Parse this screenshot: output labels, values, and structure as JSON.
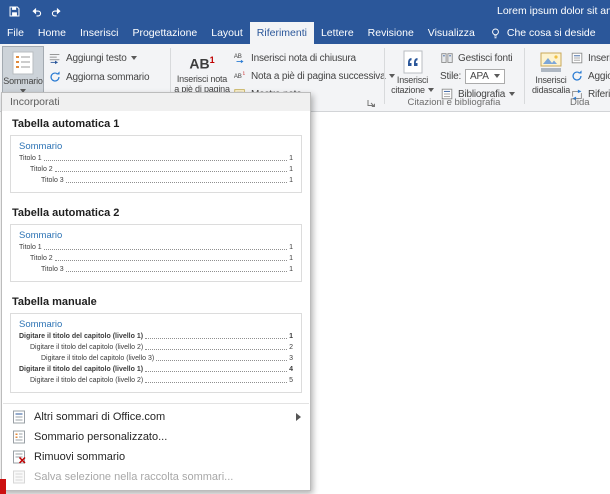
{
  "colors": {
    "titlebar": "#2b579a",
    "active_tab_text": "#2b579a",
    "toc_heading_blue": "#2e74b5",
    "ribbon_bg": "#f3f4f6"
  },
  "titlebar": {
    "title": "Lorem ipsum dolor sit amet - Wo"
  },
  "tabs": {
    "file": "File",
    "items": [
      {
        "label": "Home"
      },
      {
        "label": "Inserisci"
      },
      {
        "label": "Progettazione"
      },
      {
        "label": "Layout"
      },
      {
        "label": "Riferimenti"
      },
      {
        "label": "Lettere"
      },
      {
        "label": "Revisione"
      },
      {
        "label": "Visualizza"
      }
    ],
    "tellme": "Che cosa si deside"
  },
  "ribbon": {
    "sommario_label": "Sommario",
    "aggiungi_testo": "Aggiungi testo",
    "aggiorna_sommario": "Aggiorna sommario",
    "footnote_glyph": "AB",
    "footnote_sup": "1",
    "footnote_line1": "Inserisci nota",
    "footnote_line2": "a piè di pagina",
    "nota_chiusura": "Inserisci nota di chiusura",
    "nota_successiva": "Nota a piè di pagina successiva",
    "mostra_note": "Mostra note",
    "citazione_line1": "Inserisci",
    "citazione_line2": "citazione",
    "gestisci_fonti": "Gestisci fonti",
    "stile_label": "Stile:",
    "stile_value": "APA",
    "bibliografia": "Bibliografia",
    "group_citazioni": "Citazioni e bibliografia",
    "didascalia_line1": "Inserisci",
    "didascalia_line2": "didascalia",
    "right_row1": "Inserisci",
    "right_row2": "Aggio",
    "right_row3": "Riferin",
    "group_dida": "Dida"
  },
  "dropdown": {
    "header": "Incorporati",
    "auto1": {
      "title": "Tabella automatica 1",
      "heading": "Sommario",
      "rows": [
        {
          "text": "Titolo 1",
          "page": "1"
        },
        {
          "text": "Titolo 2",
          "page": "1"
        },
        {
          "text": "Titolo 3",
          "page": "1"
        }
      ]
    },
    "auto2": {
      "title": "Tabella automatica 2",
      "heading": "Sommario",
      "rows": [
        {
          "text": "Titolo 1",
          "page": "1"
        },
        {
          "text": "Titolo 2",
          "page": "1"
        },
        {
          "text": "Titolo 3",
          "page": "1"
        }
      ]
    },
    "manual": {
      "title": "Tabella manuale",
      "heading": "Sommario",
      "rows": [
        {
          "text": "Digitare il titolo del capitolo (livello 1)",
          "page": "1"
        },
        {
          "text": "Digitare il titolo del capitolo (livello 2)",
          "page": "2"
        },
        {
          "text": "Digitare il titolo del capitolo (livello 3)",
          "page": "3"
        },
        {
          "text": "Digitare il titolo del capitolo (livello 1)",
          "page": "4"
        },
        {
          "text": "Digitare il titolo del capitolo (livello 2)",
          "page": "5"
        }
      ]
    },
    "menu": [
      {
        "label": "Altri sommari di Office.com"
      },
      {
        "label": "Sommario personalizzato..."
      },
      {
        "label": "Rimuovi sommario"
      },
      {
        "label": "Salva selezione nella raccolta sommari..."
      }
    ]
  }
}
